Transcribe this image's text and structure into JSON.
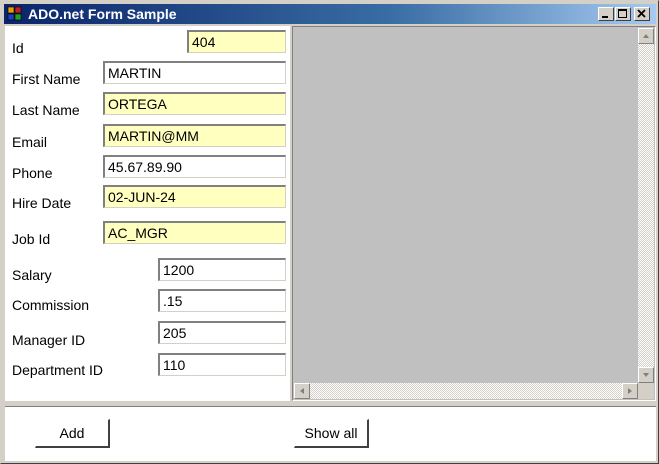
{
  "window": {
    "title": "ADO.net Form Sample"
  },
  "form": {
    "id": {
      "label": "Id",
      "value": "404"
    },
    "first_name": {
      "label": "First Name",
      "value": "MARTIN"
    },
    "last_name": {
      "label": "Last Name",
      "value": "ORTEGA"
    },
    "email": {
      "label": "Email",
      "value": "MARTIN@MM"
    },
    "phone": {
      "label": "Phone",
      "value": "45.67.89.90"
    },
    "hire_date": {
      "label": "Hire Date",
      "value": "02-JUN-24"
    },
    "job_id": {
      "label": "Job Id",
      "value": "AC_MGR"
    },
    "salary": {
      "label": "Salary",
      "value": "1200"
    },
    "commission": {
      "label": "Commission",
      "value": ".15"
    },
    "manager_id": {
      "label": "Manager ID",
      "value": "205"
    },
    "department_id": {
      "label": "Department ID",
      "value": "110"
    }
  },
  "buttons": {
    "add": "Add",
    "show_all": "Show all"
  },
  "colors": {
    "required_field_bg": "#ffffc0",
    "titlebar_start": "#0a246a",
    "titlebar_end": "#a6caf0",
    "grid_bg": "#c0c0c0"
  },
  "icons": [
    "app-icon",
    "minimize-icon",
    "maximize-icon",
    "close-icon",
    "scroll-up-arrow-icon",
    "scroll-down-arrow-icon",
    "scroll-left-arrow-icon",
    "scroll-right-arrow-icon"
  ]
}
